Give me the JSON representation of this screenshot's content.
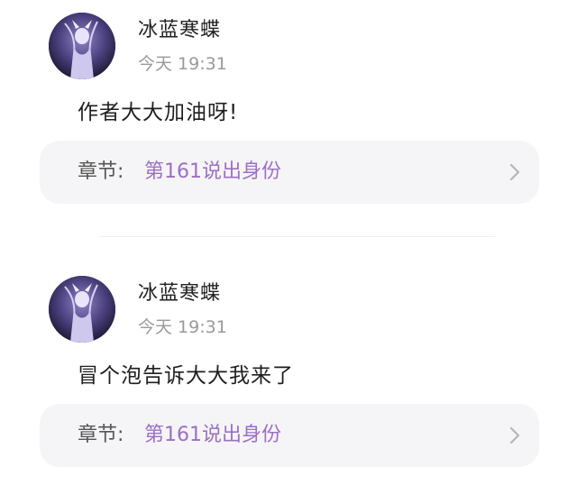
{
  "comments": [
    {
      "username": "冰蓝寒蝶",
      "time": "今天 19:31",
      "text": "作者大大加油呀!",
      "chapter_label": "章节:",
      "chapter_title": "第161说出身份"
    },
    {
      "username": "冰蓝寒蝶",
      "time": "今天 19:31",
      "text": "冒个泡告诉大大我来了",
      "chapter_label": "章节:",
      "chapter_title": "第161说出身份"
    }
  ],
  "colors": {
    "chapter_link": "#9d6fc4",
    "card_bg": "#f5f5f7",
    "timestamp": "#9a9a9a"
  },
  "icons": {
    "chevron": "chevron-right-icon"
  }
}
